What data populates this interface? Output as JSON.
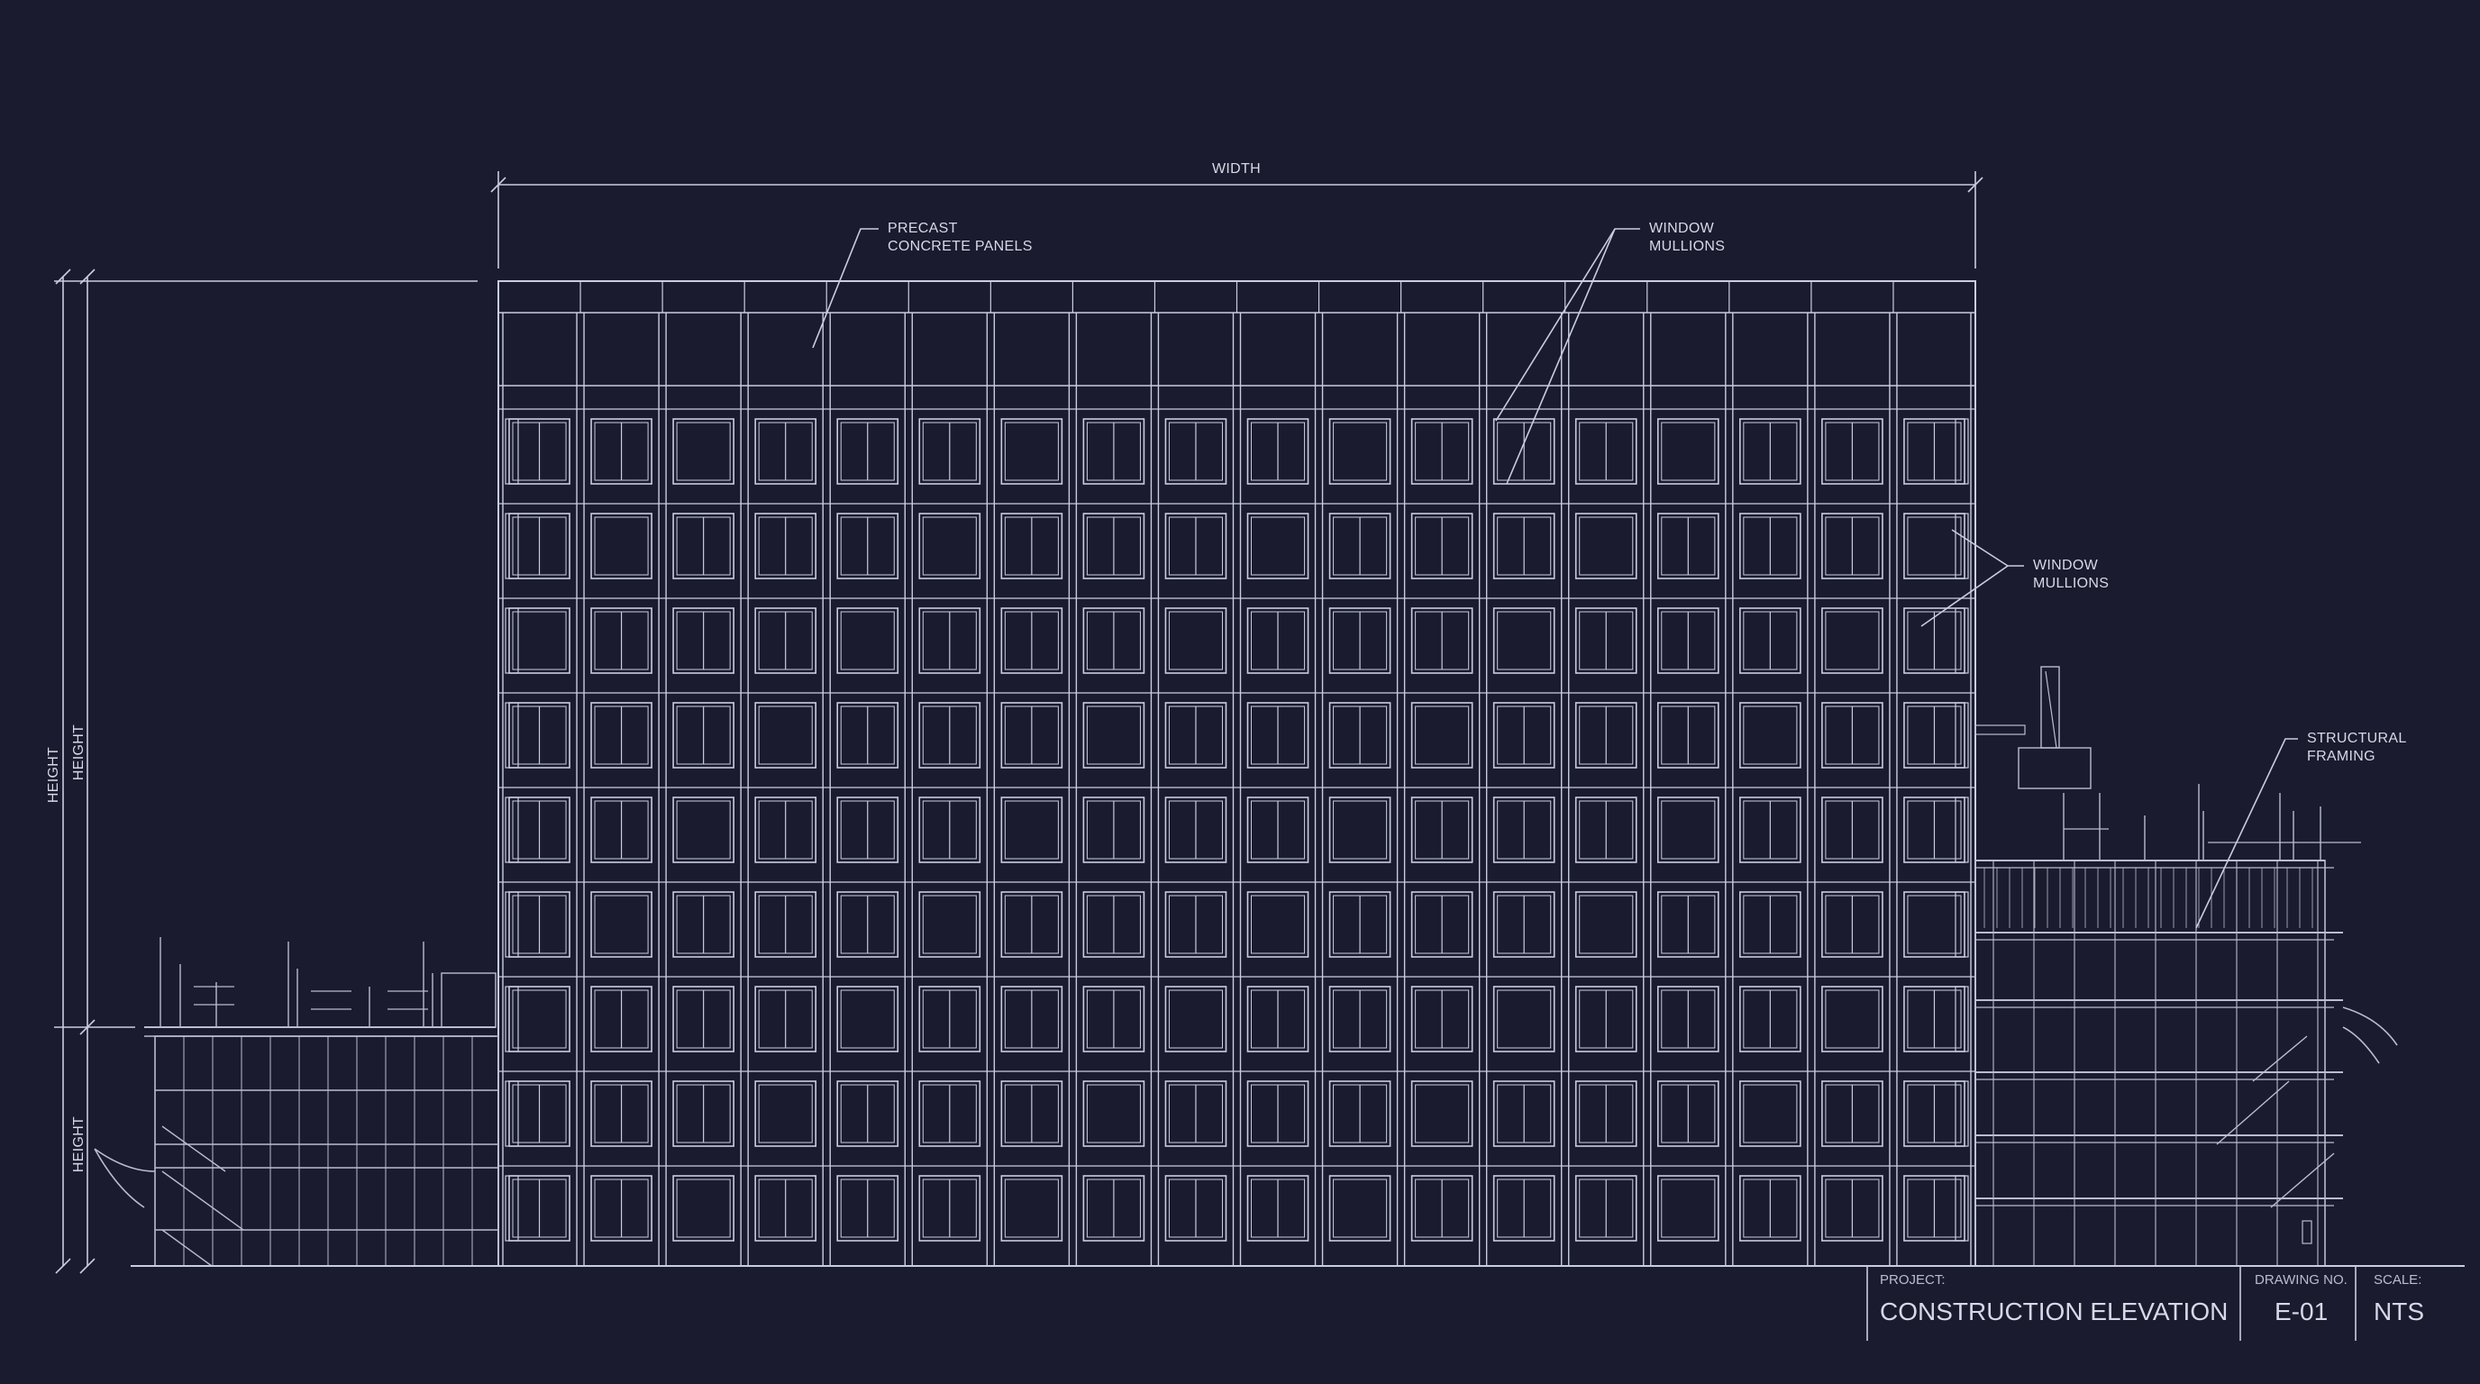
{
  "dimensions": {
    "width_label": "WIDTH",
    "height_labels": [
      "HEIGHT",
      "HEIGHT",
      "HEIGHT"
    ]
  },
  "callouts": {
    "precast": [
      "PRECAST",
      "CONCRETE PANELS"
    ],
    "mullions_top": [
      "WINDOW",
      "MULLIONS"
    ],
    "mullions_right": [
      "WINDOW",
      "MULLIONS"
    ],
    "structural": [
      "STRUCTURAL",
      "FRAMING"
    ]
  },
  "title_block": {
    "project_label": "PROJECT:",
    "project_value": "CONSTRUCTION ELEVATION",
    "drawing_no_label": "DRAWING NO.",
    "drawing_no_value": "E-01",
    "scale_label": "SCALE:",
    "scale_value": "NTS"
  },
  "colors": {
    "background": "#1a1b2e",
    "linework": "#c9cde0",
    "text": "#d6d9e6"
  }
}
